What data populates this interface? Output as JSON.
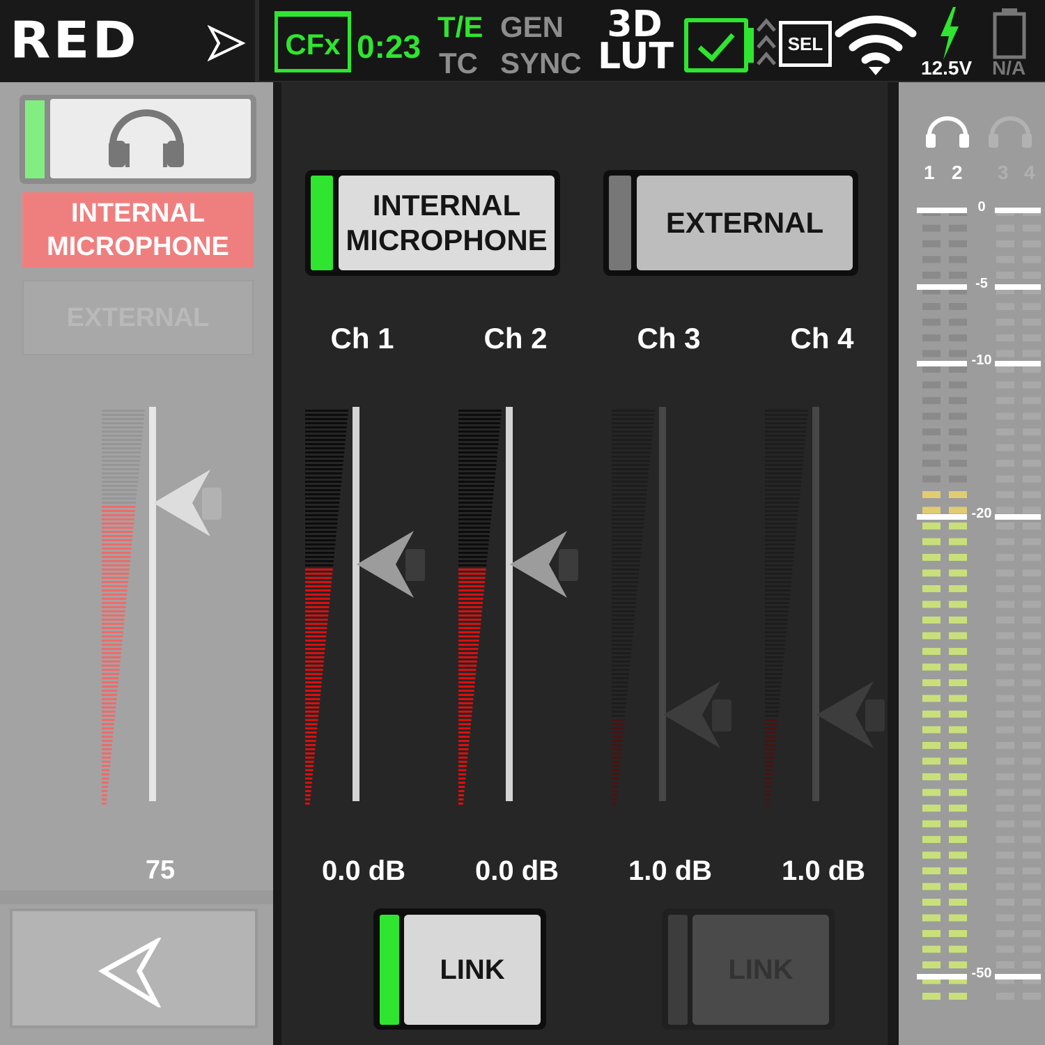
{
  "header": {
    "logo": "RED",
    "media": "CFx",
    "record_time": "0:23",
    "te": "T/E",
    "tc": "TC",
    "gen": "GEN",
    "sync": "SYNC",
    "lut_top": "3D",
    "lut_bottom": "LUT",
    "sel": "SEL",
    "voltage": "12.5V",
    "battery_status": "N/A",
    "colors": {
      "active_green": "#2fe52f",
      "inactive_gray": "#8d8d8d"
    }
  },
  "left_panel": {
    "internal_label": "INTERNAL MICROPHONE",
    "external_label": "EXTERNAL",
    "headphone_volume": "75",
    "headphone_level": 0.75
  },
  "center_panel": {
    "source_internal": "INTERNAL MICROPHONE",
    "source_external": "EXTERNAL",
    "channels": [
      {
        "label": "Ch 1",
        "gain": "0.0 dB",
        "active": true
      },
      {
        "label": "Ch 2",
        "gain": "0.0 dB",
        "active": true
      },
      {
        "label": "Ch 3",
        "gain": "1.0 dB",
        "active": false
      },
      {
        "label": "Ch 4",
        "gain": "1.0 dB",
        "active": false
      }
    ],
    "link_label": "LINK",
    "link_1_2_enabled": true,
    "link_3_4_enabled": false
  },
  "right_panel": {
    "channel_numbers": [
      "1",
      "2",
      "3",
      "4"
    ],
    "scale_labels": [
      "0",
      "-5",
      "-10",
      "-20",
      "-50"
    ]
  }
}
